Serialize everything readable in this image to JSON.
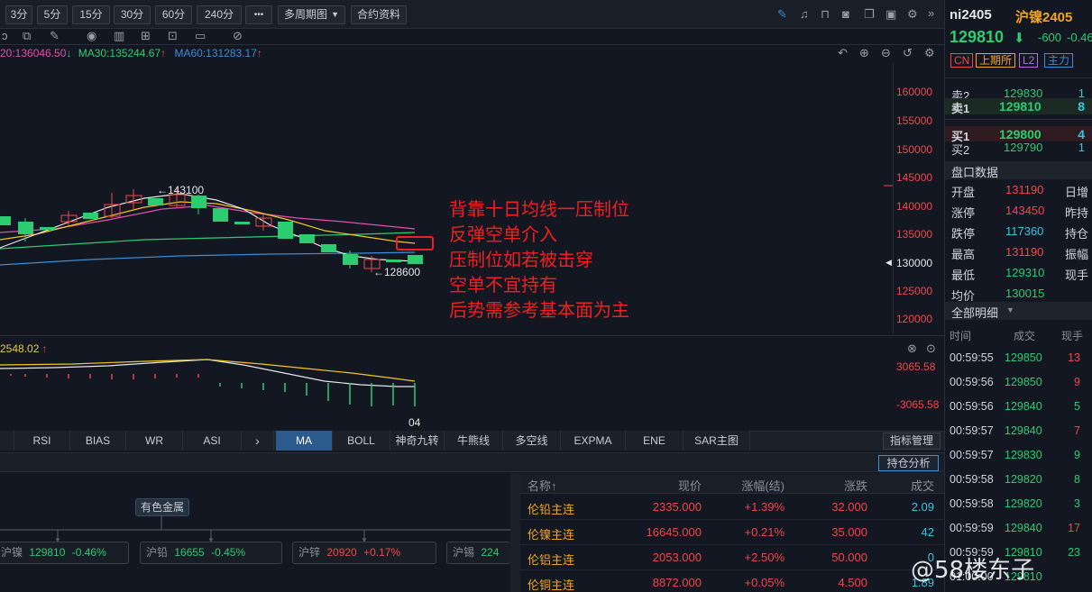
{
  "toolbar": {
    "periods": [
      "3分",
      "5分",
      "15分",
      "30分",
      "60分",
      "240分"
    ],
    "more_label": "•••",
    "multi_period_label": "多周期图",
    "contract_info_label": "合约资料"
  },
  "ma_line": {
    "ma20": "20:136046.50",
    "ma30": "MA30:135244.67",
    "ma60": "MA60:131283.17",
    "ma20_arrow": "↓",
    "ma30_arrow": "↑",
    "ma60_arrow": "↑"
  },
  "price_axis": [
    "160000",
    "155000",
    "150000",
    "145000",
    "140000",
    "135000",
    "130000",
    "125000",
    "120000"
  ],
  "chart_labels": {
    "high_label": "←143100",
    "low_label": "←128600",
    "x_tick": "04"
  },
  "annotation": [
    "背靠十日均线一压制位",
    "反弹空单介入",
    "压制位如若被击穿",
    "空单不宜持有",
    "后势需参考基本面为主"
  ],
  "macd": {
    "value": "2548.02",
    "arrow": "↑",
    "top_label": "3065.58",
    "bottom_label": "-3065.58"
  },
  "indicator_tabs_left": [
    "RSI",
    "BIAS",
    "WR",
    "ASI"
  ],
  "indicator_tabs_right": [
    "MA",
    "BOLL",
    "神奇九转",
    "牛熊线",
    "多空线",
    "EXPMA",
    "ENE",
    "SAR主图"
  ],
  "indicator_manage": "指标管理",
  "position_analysis": "持仓分析",
  "sector": {
    "label": "有色金属",
    "pills": [
      {
        "name": "沪镍",
        "price": "129810",
        "change": "-0.46%"
      },
      {
        "name": "沪铅",
        "price": "16655",
        "change": "-0.45%"
      },
      {
        "name": "沪锌",
        "price": "20920",
        "change": "+0.17%"
      },
      {
        "name": "沪锡",
        "price": "224"
      }
    ]
  },
  "table": {
    "headers": [
      "名称↑",
      "现价",
      "涨幅(结)",
      "涨跌",
      "成交"
    ],
    "rows": [
      [
        "伦铅主连",
        "2335.000",
        "+1.39%",
        "32.000",
        "2.09"
      ],
      [
        "伦镍主连",
        "16645.000",
        "+0.21%",
        "35.000",
        "42"
      ],
      [
        "伦铝主连",
        "2053.000",
        "+2.50%",
        "50.000",
        "0"
      ],
      [
        "伦铜主连",
        "8872.000",
        "+0.05%",
        "4.500",
        "1.89"
      ]
    ]
  },
  "right_panel": {
    "code": "ni2405",
    "name": "沪镍2405",
    "price": "129810",
    "arrow": "⬇",
    "change": "-600",
    "change_pct": "-0.46",
    "badges": [
      "CN",
      "上期所",
      "L2",
      "主力"
    ],
    "sell2": {
      "label": "卖2",
      "price": "129830",
      "vol": "1"
    },
    "sell1": {
      "label": "卖1",
      "price": "129810",
      "vol": "8"
    },
    "buy1": {
      "label": "买1",
      "price": "129800",
      "vol": "4"
    },
    "buy2": {
      "label": "买2",
      "price": "129790",
      "vol": "1"
    },
    "pankou_title": "盘口数据",
    "stats": [
      {
        "label": "开盘",
        "value": "131190",
        "extra": "日增"
      },
      {
        "label": "涨停",
        "value": "143450",
        "extra": "昨持"
      },
      {
        "label": "跌停",
        "value": "117360",
        "extra": "持仓"
      },
      {
        "label": "最高",
        "value": "131190",
        "extra": "振幅"
      },
      {
        "label": "最低",
        "value": "129310",
        "extra": "现手"
      },
      {
        "label": "均价",
        "value": "130015",
        "extra": ""
      }
    ],
    "detail_title": "全部明细",
    "detail_headers": [
      "时间",
      "成交",
      "现手"
    ],
    "trades": [
      {
        "time": "00:59:55",
        "price": "129850",
        "vol": "13"
      },
      {
        "time": "00:59:56",
        "price": "129850",
        "vol": "9"
      },
      {
        "time": "00:59:56",
        "price": "129840",
        "vol": "5"
      },
      {
        "time": "00:59:57",
        "price": "129840",
        "vol": "7"
      },
      {
        "time": "00:59:57",
        "price": "129830",
        "vol": "9"
      },
      {
        "time": "00:59:58",
        "price": "129820",
        "vol": "8"
      },
      {
        "time": "00:59:58",
        "price": "129820",
        "vol": "3"
      },
      {
        "time": "00:59:59",
        "price": "129840",
        "vol": "17"
      },
      {
        "time": "00:59:59",
        "price": "129810",
        "vol": "23"
      },
      {
        "time": "01:00:00",
        "price": "129810",
        "vol": ""
      }
    ]
  },
  "watermark": "@58楼东子",
  "colors": {
    "up": "#f04848",
    "down": "#2ecc71",
    "bg": "#131722",
    "ma20": "#e04fb0",
    "ma30": "#2ecc71",
    "ma60": "#3a8fd9"
  }
}
